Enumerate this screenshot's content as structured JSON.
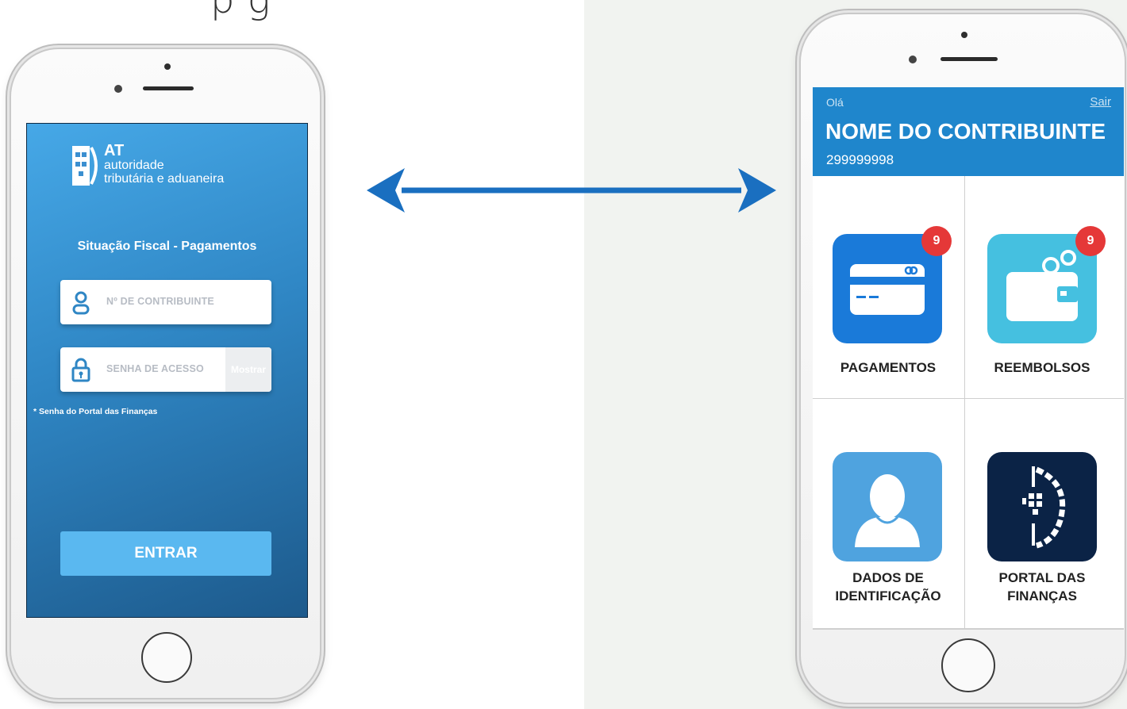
{
  "top_caption": "p         g",
  "login_screen": {
    "logo": {
      "abbr": "AT",
      "line1": "autoridade",
      "line2": "tributária e aduaneira"
    },
    "title": "Situação Fiscal - Pagamentos",
    "nif_placeholder": "Nº DE CONTRIBUINTE",
    "password_placeholder": "SENHA DE ACESSO",
    "show_label": "Mostrar",
    "note": "* Senha do Portal das Finanças",
    "submit_label": "ENTRAR",
    "colors": {
      "gradient_top": "#46a8e7",
      "gradient_bottom": "#1d5a8c",
      "button": "#5ab8f0"
    }
  },
  "home_screen": {
    "greeting": "Olá",
    "logout_label": "Sair",
    "taxpayer_name": "NOME DO CONTRIBUINTE",
    "taxpayer_nif": "299999998",
    "tiles": [
      {
        "label": "PAGAMENTOS",
        "badge": "9",
        "icon": "credit-card-icon",
        "color": "#1a7ad9"
      },
      {
        "label": "REEMBOLSOS",
        "badge": "9",
        "icon": "wallet-icon",
        "color": "#45c0e0"
      },
      {
        "label1": "DADOS DE",
        "label2": "IDENTIFICAÇÃO",
        "icon": "person-icon",
        "color": "#4fa3df"
      },
      {
        "label1": "PORTAL DAS",
        "label2": "FINANÇAS",
        "icon": "portal-financas-logo-icon",
        "color": "#0b2346"
      }
    ],
    "colors": {
      "header": "#1f86cc",
      "badge": "#e53838"
    }
  },
  "connector": {
    "icon": "double-arrow-icon",
    "color": "#1a6fc0"
  }
}
